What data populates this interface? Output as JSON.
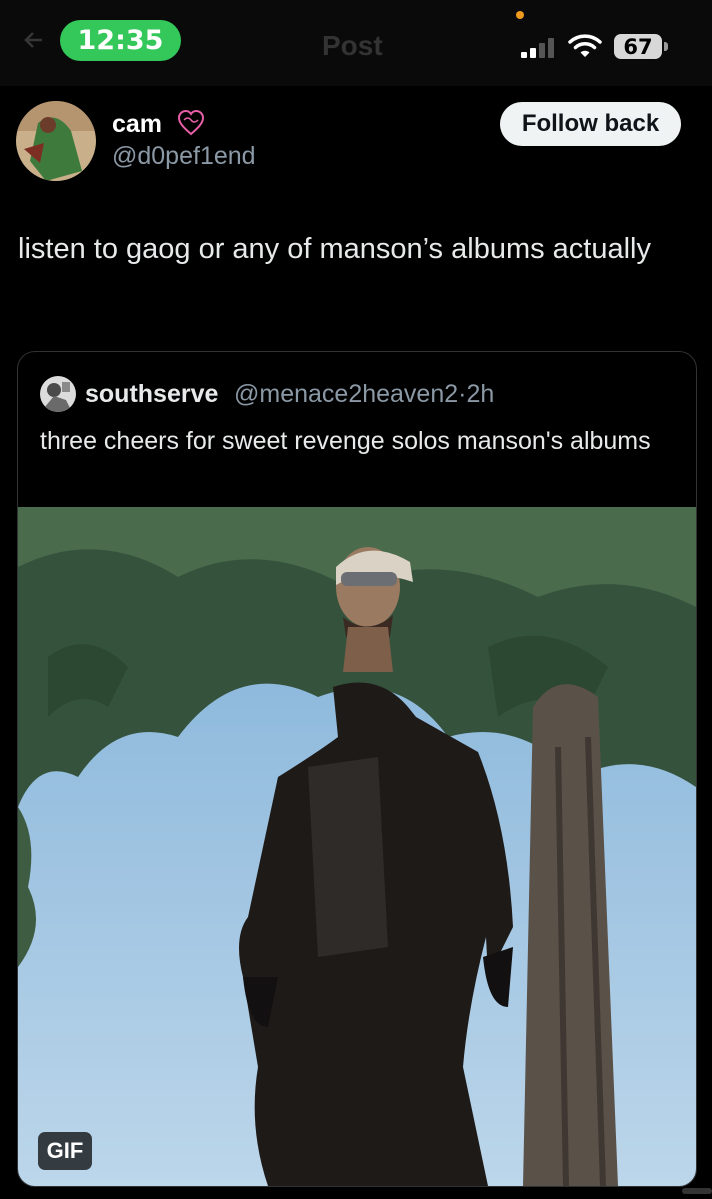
{
  "status_bar": {
    "time": "12:35",
    "battery": "67",
    "icons": [
      "signal-icon",
      "wifi-icon",
      "battery-icon"
    ]
  },
  "header": {
    "title": "Post",
    "back_icon": "back-arrow-icon"
  },
  "author": {
    "display_name": "cam",
    "badge_icon": "heart-outline-icon",
    "handle": "@d0pef1end",
    "follow_label": "Follow back"
  },
  "post": {
    "text": "listen to gaog or any of manson’s albums actually"
  },
  "quoted": {
    "display_name": "southserve",
    "handle": "@menace2heaven2",
    "separator": "·",
    "time": "2h",
    "text": "three cheers for sweet revenge solos manson's albums",
    "media_badge": "GIF"
  },
  "colors": {
    "background": "#000000",
    "time_pill": "#34c759",
    "follow_button": "#eff3f4",
    "muted_text": "#8b98a5",
    "card_border": "#2f3336"
  }
}
